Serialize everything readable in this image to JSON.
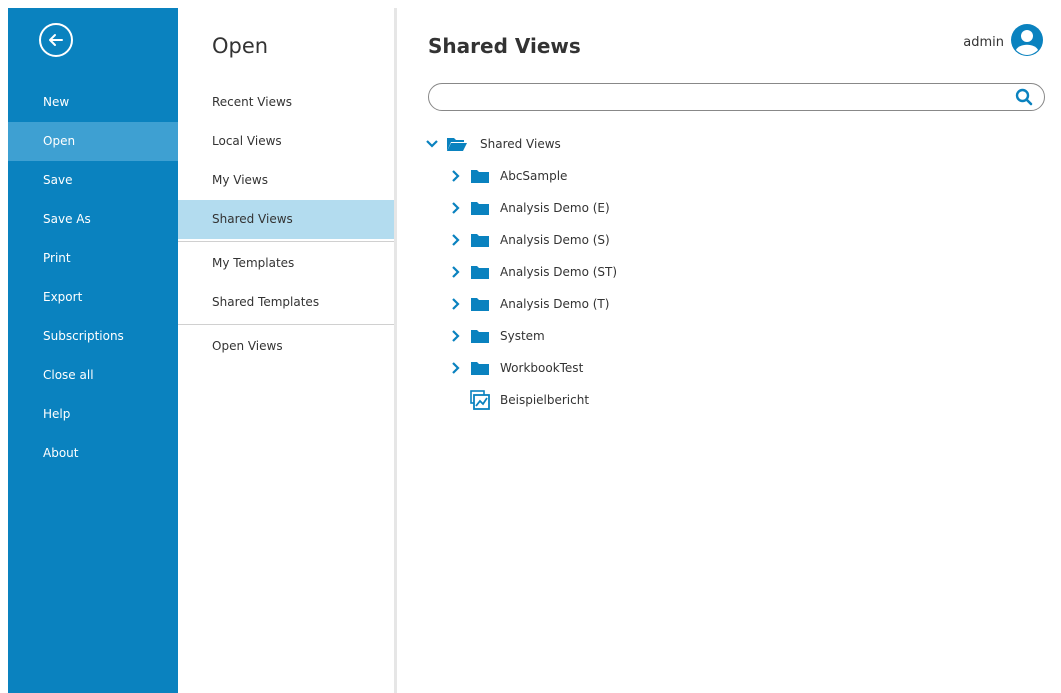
{
  "user": {
    "name": "admin"
  },
  "nav": {
    "items": [
      {
        "label": "New"
      },
      {
        "label": "Open",
        "active": true
      },
      {
        "label": "Save"
      },
      {
        "label": "Save As"
      },
      {
        "label": "Print"
      },
      {
        "label": "Export"
      },
      {
        "label": "Subscriptions"
      },
      {
        "label": "Close all"
      },
      {
        "label": "Help"
      },
      {
        "label": "About"
      }
    ]
  },
  "open_panel": {
    "title": "Open",
    "items": [
      {
        "label": "Recent Views"
      },
      {
        "label": "Local Views"
      },
      {
        "label": "My Views"
      },
      {
        "label": "Shared Views",
        "active": true
      },
      {
        "label": "My Templates"
      },
      {
        "label": "Shared Templates"
      },
      {
        "label": "Open Views"
      }
    ]
  },
  "content": {
    "title": "Shared Views",
    "search": {
      "value": "",
      "placeholder": ""
    },
    "tree": {
      "root": {
        "label": "Shared Views",
        "expanded": true,
        "icon": "folder-open-icon"
      },
      "children": [
        {
          "label": "AbcSample",
          "type": "folder",
          "icon": "folder-icon"
        },
        {
          "label": "Analysis Demo (E)",
          "type": "folder",
          "icon": "folder-icon"
        },
        {
          "label": "Analysis Demo (S)",
          "type": "folder",
          "icon": "folder-icon"
        },
        {
          "label": "Analysis Demo (ST)",
          "type": "folder",
          "icon": "folder-icon"
        },
        {
          "label": "Analysis Demo (T)",
          "type": "folder",
          "icon": "folder-icon"
        },
        {
          "label": "System",
          "type": "folder",
          "icon": "folder-icon"
        },
        {
          "label": "WorkbookTest",
          "type": "folder",
          "icon": "folder-icon"
        },
        {
          "label": "Beispielbericht",
          "type": "view",
          "icon": "report-view-icon"
        }
      ]
    }
  },
  "colors": {
    "rail": "#0a82bf",
    "rail_active": "#3ea0d2",
    "mid_active": "#b3dcef",
    "icon_blue": "#0a82bf"
  }
}
